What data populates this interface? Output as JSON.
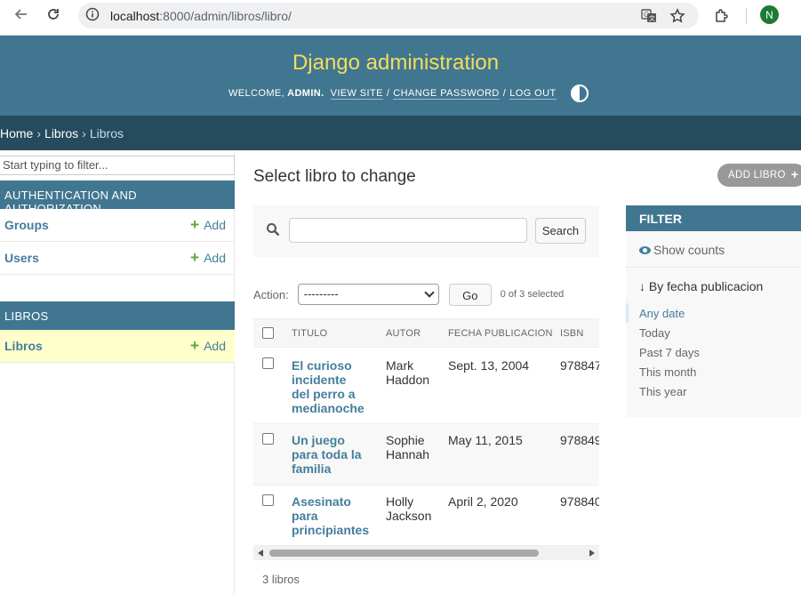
{
  "browser": {
    "url_host": "localhost",
    "url_rest": ":8000/admin/libros/libro/",
    "avatar_letter": "N"
  },
  "header": {
    "site_title": "Django administration",
    "welcome": "WELCOME,",
    "username": "ADMIN.",
    "view_site": "VIEW SITE",
    "change_password": "CHANGE PASSWORD",
    "log_out": "LOG OUT",
    "sep": "/"
  },
  "breadcrumbs": {
    "home": "Home",
    "app": "Libros",
    "current": "Libros",
    "sep": "›"
  },
  "sidebar": {
    "filter_placeholder": "Start typing to filter...",
    "modules": [
      {
        "caption": "AUTHENTICATION AND AUTHORIZATION",
        "rows": [
          {
            "name": "Groups",
            "add": "Add"
          },
          {
            "name": "Users",
            "add": "Add"
          }
        ]
      },
      {
        "caption": "LIBROS",
        "rows": [
          {
            "name": "Libros",
            "add": "Add"
          }
        ]
      }
    ]
  },
  "main": {
    "title": "Select libro to change",
    "add_button": "ADD LIBRO",
    "search_button": "Search",
    "action_label": "Action:",
    "action_selected": "---------",
    "go_button": "Go",
    "selection_counter": "0 of 3 selected",
    "columns": [
      "TITULO",
      "AUTOR",
      "FECHA PUBLICACION",
      "ISBN"
    ],
    "rows": [
      {
        "titulo": [
          "El curioso",
          "incidente",
          "del perro a",
          "medianoche"
        ],
        "autor": [
          "Mark",
          "Haddon"
        ],
        "fecha": "Sept. 13, 2004",
        "isbn": "978847"
      },
      {
        "titulo": [
          "Un juego",
          "para toda la",
          "familia"
        ],
        "autor": [
          "Sophie",
          "Hannah"
        ],
        "fecha": "May 11, 2015",
        "isbn": "978849"
      },
      {
        "titulo": [
          "Asesinato",
          "para",
          "principiantes"
        ],
        "autor": [
          "Holly",
          "Jackson"
        ],
        "fecha": "April 2, 2020",
        "isbn": "978840"
      }
    ],
    "paginator": "3 libros"
  },
  "filter": {
    "title": "FILTER",
    "show_counts": "Show counts",
    "field": "↓ By fecha publicacion",
    "options": [
      "Any date",
      "Today",
      "Past 7 days",
      "This month",
      "This year"
    ],
    "selected_option": "Any date"
  },
  "colors": {
    "header_bg": "#417690",
    "breadcrumb_bg": "#264b5d",
    "site_title": "#f5dd5d",
    "link": "#447e9b",
    "add_plus": "#5ba63a",
    "current_row": "#ffffcc"
  }
}
